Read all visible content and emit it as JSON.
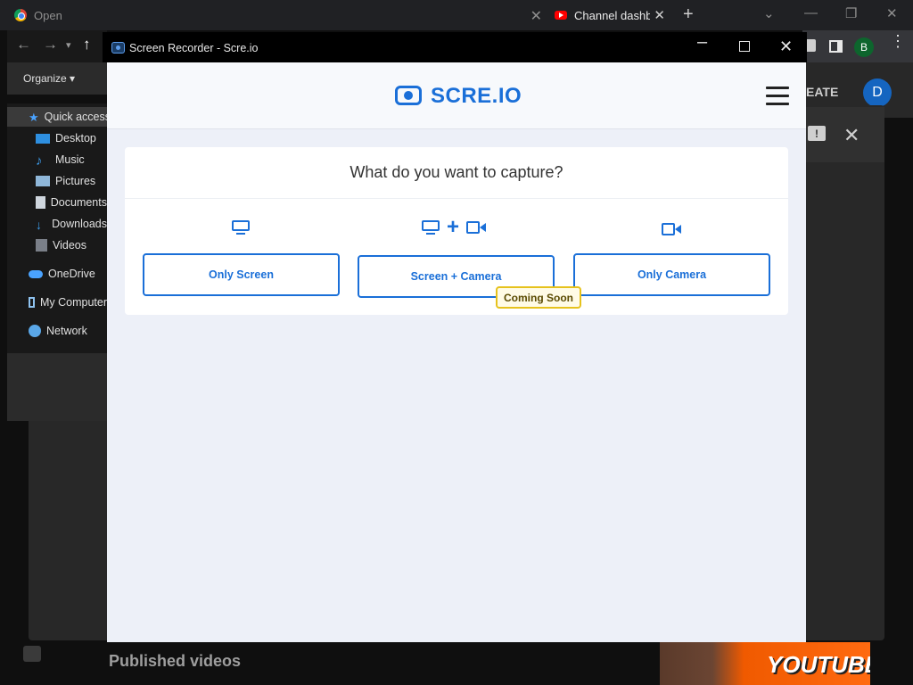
{
  "browser": {
    "tabs": [
      {
        "title": "Open"
      },
      {
        "title": "Channel dashboard"
      }
    ],
    "new_tab": "+",
    "profile_initial": "B"
  },
  "explorer": {
    "organize_label": "Organize ▾",
    "tree": [
      {
        "label": "Quick access",
        "icon": "star-icon"
      },
      {
        "label": "Desktop",
        "icon": "desktop-folder-icon"
      },
      {
        "label": "Music",
        "icon": "music-note-icon"
      },
      {
        "label": "Pictures",
        "icon": "pictures-folder-icon"
      },
      {
        "label": "Documents",
        "icon": "documents-folder-icon"
      },
      {
        "label": "Downloads",
        "icon": "download-arrow-icon"
      },
      {
        "label": "Videos",
        "icon": "videos-folder-icon"
      },
      {
        "label": "OneDrive",
        "icon": "cloud-icon"
      },
      {
        "label": "My Computer",
        "icon": "computer-icon"
      },
      {
        "label": "Network",
        "icon": "network-icon"
      }
    ]
  },
  "youtube": {
    "create_label": "EATE",
    "account_initial": "D",
    "section_heading": "Published videos",
    "thumbnail_text": "YOUTUBE"
  },
  "popup": {
    "window_title": "Screen Recorder - Scre.io",
    "site": {
      "logo_text": "SCRE.IO",
      "question": "What do you want to capture?",
      "options": [
        {
          "label": "Only Screen",
          "icon": "monitor-icon"
        },
        {
          "label": "Screen + Camera",
          "icon": "monitor-plus-camera-icon",
          "badge": "Coming Soon"
        },
        {
          "label": "Only Camera",
          "icon": "video-camera-icon"
        }
      ],
      "plus_glyph": "+"
    }
  },
  "colors": {
    "accent": "#1a6fd8",
    "badge_border": "#e6c21c",
    "page_bg": "#edf0f8"
  }
}
